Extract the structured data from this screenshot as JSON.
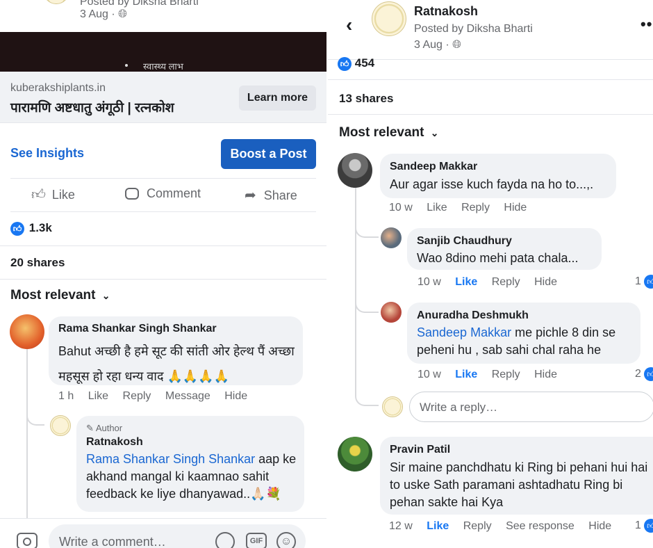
{
  "left": {
    "post_header": {
      "posted_by": "Posted by Diksha Bharti",
      "date": "3 Aug · "
    },
    "banner_text": "स्वास्थ्य लाभ",
    "ad": {
      "domain": "kuberakshiplants.in",
      "title": "पारामणि अष्टधातु अंगूठी | रत्नकोश",
      "cta": "Learn more"
    },
    "insights_label": "See Insights",
    "boost_label": "Boost a Post",
    "actions": {
      "like": "Like",
      "comment": "Comment",
      "share": "Share"
    },
    "reactions_count": "1.3k",
    "shares": "20 shares",
    "sort_label": "Most relevant",
    "comments": [
      {
        "name": "Rama Shankar Singh Shankar",
        "text": "Bahut अच्छी है हमे सूट की सांती ओर हेल्थ पैं अच्छा महसूस हो रहा धन्य वाद 🙏🙏🙏🙏",
        "time": "1 h",
        "like": "Like",
        "reply": "Reply",
        "message": "Message",
        "hide": "Hide"
      }
    ],
    "reply": {
      "badge": "Author",
      "name": "Ratnakosh",
      "mention": "Rama Shankar Singh Shankar",
      "text": " aap ke akhand mangal ki kaamnao sahit feedback ke liye dhanyawad..🙏🏻💐"
    },
    "composer_placeholder": "Write a comment…",
    "composer_gif": "GIF"
  },
  "right": {
    "page_name": "Ratnakosh",
    "posted_by": "Posted by Diksha Bharti",
    "date": "3 Aug · ",
    "reactions_count": "454",
    "shares": "13 shares",
    "sort_label": "Most relevant",
    "comments": [
      {
        "name": "Sandeep Makkar",
        "text": "Aur agar isse kuch fayda na ho to...,.",
        "time": "10 w",
        "like": "Like",
        "reply": "Reply",
        "hide": "Hide"
      },
      {
        "name": "Sanjib Chaudhury",
        "text": "Wao 8dino mehi pata chala...",
        "time": "10 w",
        "like": "Like",
        "reply": "Reply",
        "hide": "Hide",
        "likes": "1"
      },
      {
        "name": "Anuradha Deshmukh",
        "mention": "Sandeep Makkar",
        "text": " me pichle 8 din se peheni hu , sab sahi chal raha he",
        "time": "10 w",
        "like": "Like",
        "reply": "Reply",
        "hide": "Hide",
        "likes": "2"
      },
      {
        "name": "Pravin Patil",
        "text": "Sir maine panchdhatu ki Ring bi pehani hui hai to uske Sath paramani ashtadhatu Ring bi pehan sakte hai Kya",
        "time": "12 w",
        "like": "Like",
        "reply": "Reply",
        "see_response": "See response",
        "hide": "Hide",
        "likes": "1"
      }
    ],
    "reply_placeholder": "Write a reply…"
  },
  "colors": {
    "accent": "#1877f2",
    "boost_bg": "#1a5fbf",
    "bubble": "#f0f2f5",
    "meta": "#65676b"
  },
  "icons": [
    "globe-icon",
    "thumbs-up-icon",
    "comment-icon",
    "share-icon",
    "chevron-down-icon",
    "back-icon",
    "more-icon",
    "camera-icon",
    "sticker-icon",
    "gif-icon",
    "emoji-icon",
    "pencil-icon"
  ]
}
